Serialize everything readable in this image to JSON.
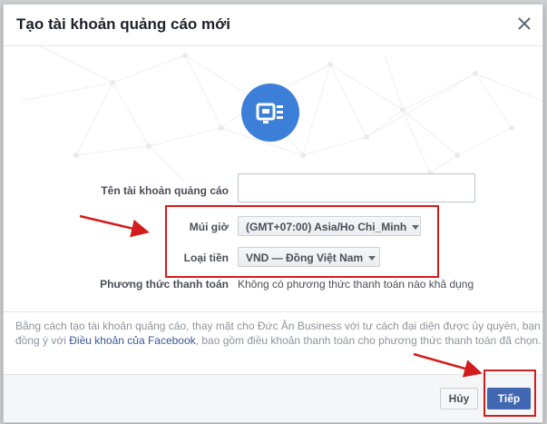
{
  "dialog": {
    "title": "Tạo tài khoản quảng cáo mới",
    "close_label": "×"
  },
  "form": {
    "account_name": {
      "label": "Tên tài khoản quảng cáo",
      "value": "",
      "placeholder": ""
    },
    "timezone": {
      "label": "Múi giờ",
      "selected": "(GMT+07:00) Asia/Ho Chi_Minh"
    },
    "currency": {
      "label": "Loại tiền",
      "selected": "VND — Đồng Việt Nam"
    },
    "payment": {
      "label": "Phương thức thanh toán",
      "value": "Không có phương thức thanh toán nào khả dụng"
    }
  },
  "disclaimer": {
    "part1": "Bằng cách tạo tài khoản quảng cáo, thay mặt cho Đức Ân Business với tư cách đại diện được ủy quyền, bạn đồng ý với ",
    "link": "Điều khoản của Facebook",
    "part2": ", bao gồm điều khoản thanh toán cho phương thức thanh toán đã chọn."
  },
  "footer": {
    "cancel_label": "Hủy",
    "next_label": "Tiếp"
  },
  "colors": {
    "accent": "#4267b2",
    "icon_circle": "#3b7fd9",
    "annotation": "#d31d1d"
  },
  "icons": [
    "close-icon",
    "ad-account-icon",
    "chevron-down-icon"
  ]
}
